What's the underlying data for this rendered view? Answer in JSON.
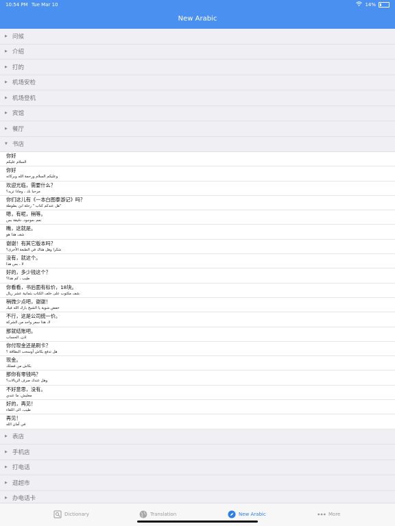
{
  "status": {
    "time": "10:54 PM",
    "date": "Tue Mar 10",
    "battery": "14%"
  },
  "header": {
    "title": "New Arabic"
  },
  "sections_top": [
    "问候",
    "介绍",
    "打的",
    "机场安检",
    "机场登机",
    "宾馆",
    "餐厅"
  ],
  "open_section": "书店",
  "phrases": [
    {
      "zh": "你好",
      "ar": "السلام عليكم"
    },
    {
      "zh": "你好",
      "ar": "وعليكم السلام ورحمة الله وبركاته"
    },
    {
      "zh": "欢迎光临，需要什么？",
      "ar": "مرحبا بك ، وماذا تريد؟"
    },
    {
      "zh": "你们这儿有《一本白图泰游记》吗？",
      "ar": "هل عندكم كتاب \" رحلة ابن بطوطة\""
    },
    {
      "zh": "嗯，有呢，稍等。",
      "ar": "نعم ،موجود، دقيقة بس"
    },
    {
      "zh": "瞧，这就是。",
      "ar": "شف هذا هو"
    },
    {
      "zh": "谢谢！有其它版本吗？",
      "ar": "شكرا وهل هناك في الطبعة الأخرى؟"
    },
    {
      "zh": "没有，就这个。",
      "ar": "لا ، بس هذا"
    },
    {
      "zh": "好的，多少钱这个？",
      "ar": "طيب ، كم هذا؟"
    },
    {
      "zh": "你看看，书后面有标价，18块。",
      "ar": "شف مكتوب على خلف الكتاب بثمانية عشر ريال."
    },
    {
      "zh": "稍微少点吧，谢谢！",
      "ar": "خفض شوية يا الشيخ بارك الله فيك"
    },
    {
      "zh": "不行，这是公司统一价。",
      "ar": "لا، هذا سعر واحد من الشركة"
    },
    {
      "zh": "那就结账吧。",
      "ar": "اذن، الحساب"
    },
    {
      "zh": "你付现金还是刷卡？",
      "ar": "هل تدفع بكاش أوسحب البطاقة ؟"
    },
    {
      "zh": "现金。",
      "ar": "بكاش من فضلك"
    },
    {
      "zh": "那你有零钱吗？",
      "ar": "وهل عندك صرف الريالات؟"
    },
    {
      "zh": "不好意思，没有。",
      "ar": "معليش، ما عندي"
    },
    {
      "zh": "好的，再见！",
      "ar": "طيب، الى اللقاء"
    },
    {
      "zh": "再见！",
      "ar": "في أمان الله"
    }
  ],
  "sections_bottom": [
    "表店",
    "手机店",
    "打电话",
    "逛超市",
    "办电话卡"
  ],
  "tabs": [
    {
      "label": "Dictionary",
      "icon": "dictionary-icon"
    },
    {
      "label": "Translation",
      "icon": "globe-icon"
    },
    {
      "label": "New Arabic",
      "icon": "compass-icon"
    },
    {
      "label": "More",
      "icon": "more-dots-icon"
    }
  ],
  "colors": {
    "nav": "#4a90f0",
    "accent": "#2b7de9"
  }
}
